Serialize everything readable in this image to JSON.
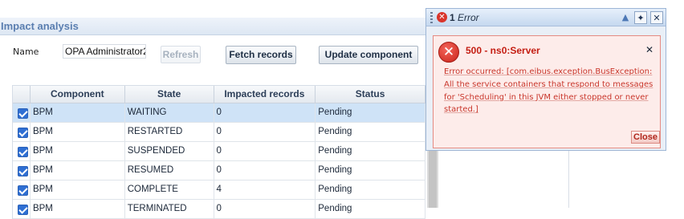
{
  "panel": {
    "title": "Impact analysis",
    "name_label": "Name",
    "name_value": "OPA Administrator2",
    "buttons": {
      "refresh": "Refresh",
      "fetch": "Fetch records",
      "update": "Update component"
    }
  },
  "grid": {
    "columns": [
      "Component",
      "State",
      "Impacted records",
      "Status"
    ],
    "rows": [
      {
        "checked": true,
        "component": "BPM",
        "state": "WAITING",
        "impacted": "0",
        "status": "Pending",
        "selected": true
      },
      {
        "checked": true,
        "component": "BPM",
        "state": "RESTARTED",
        "impacted": "0",
        "status": "Pending"
      },
      {
        "checked": true,
        "component": "BPM",
        "state": "SUSPENDED",
        "impacted": "0",
        "status": "Pending"
      },
      {
        "checked": true,
        "component": "BPM",
        "state": "RESUMED",
        "impacted": "0",
        "status": "Pending"
      },
      {
        "checked": true,
        "component": "BPM",
        "state": "COMPLETE",
        "impacted": "4",
        "status": "Pending"
      },
      {
        "checked": true,
        "component": "BPM",
        "state": "TERMINATED",
        "impacted": "0",
        "status": "Pending"
      }
    ]
  },
  "popup": {
    "count": "1",
    "title": "Error",
    "message_title": "500 - ns0:Server",
    "message_lines": [
      "Error occurred: [com.eibus.exception.BusException:",
      "All the service containers that respond to messages",
      "for 'Scheduling' in this JVM either stopped or never",
      "started.]"
    ],
    "close_label": "Close"
  }
}
